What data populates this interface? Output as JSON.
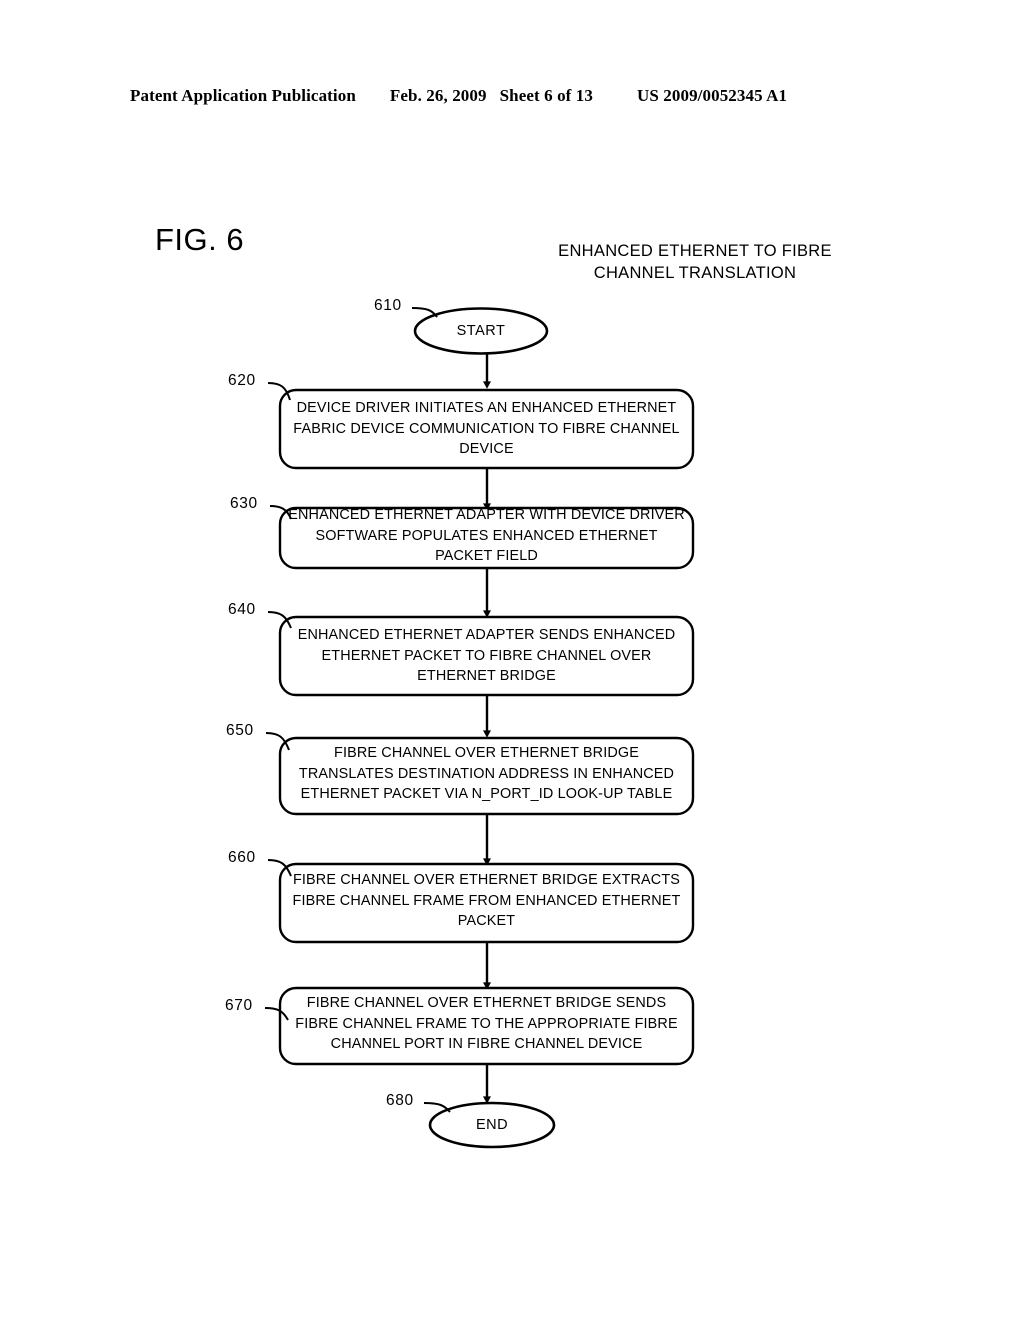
{
  "header": {
    "publication": "Patent Application Publication",
    "date": "Feb. 26, 2009",
    "sheet": "Sheet 6 of 13",
    "patent_number": "US 2009/0052345 A1"
  },
  "figure": {
    "label": "FIG. 6",
    "title_line1": "ENHANCED ETHERNET TO FIBRE",
    "title_line2": "CHANNEL TRANSLATION"
  },
  "flowchart": {
    "nodes": [
      {
        "ref": "610",
        "shape": "ellipse",
        "text": "START"
      },
      {
        "ref": "620",
        "shape": "process",
        "text": "DEVICE DRIVER INITIATES AN ENHANCED ETHERNET FABRIC DEVICE COMMUNICATION TO FIBRE CHANNEL DEVICE"
      },
      {
        "ref": "630",
        "shape": "process",
        "text": "ENHANCED ETHERNET ADAPTER WITH DEVICE DRIVER SOFTWARE POPULATES ENHANCED ETHERNET PACKET FIELD"
      },
      {
        "ref": "640",
        "shape": "process",
        "text": "ENHANCED ETHERNET ADAPTER SENDS ENHANCED ETHERNET PACKET TO FIBRE CHANNEL OVER ETHERNET BRIDGE"
      },
      {
        "ref": "650",
        "shape": "process",
        "text": "FIBRE CHANNEL OVER ETHERNET BRIDGE TRANSLATES DESTINATION ADDRESS IN ENHANCED ETHERNET PACKET VIA N_PORT_ID LOOK-UP TABLE"
      },
      {
        "ref": "660",
        "shape": "process",
        "text": "FIBRE CHANNEL OVER ETHERNET BRIDGE EXTRACTS FIBRE CHANNEL FRAME FROM ENHANCED ETHERNET PACKET"
      },
      {
        "ref": "670",
        "shape": "process",
        "text": "FIBRE CHANNEL OVER ETHERNET BRIDGE SENDS FIBRE CHANNEL FRAME TO THE APPROPRIATE FIBRE CHANNEL PORT IN FIBRE CHANNEL DEVICE"
      },
      {
        "ref": "680",
        "shape": "ellipse",
        "text": "END"
      }
    ]
  },
  "colors": {
    "ink": "#000000",
    "paper": "#ffffff"
  }
}
